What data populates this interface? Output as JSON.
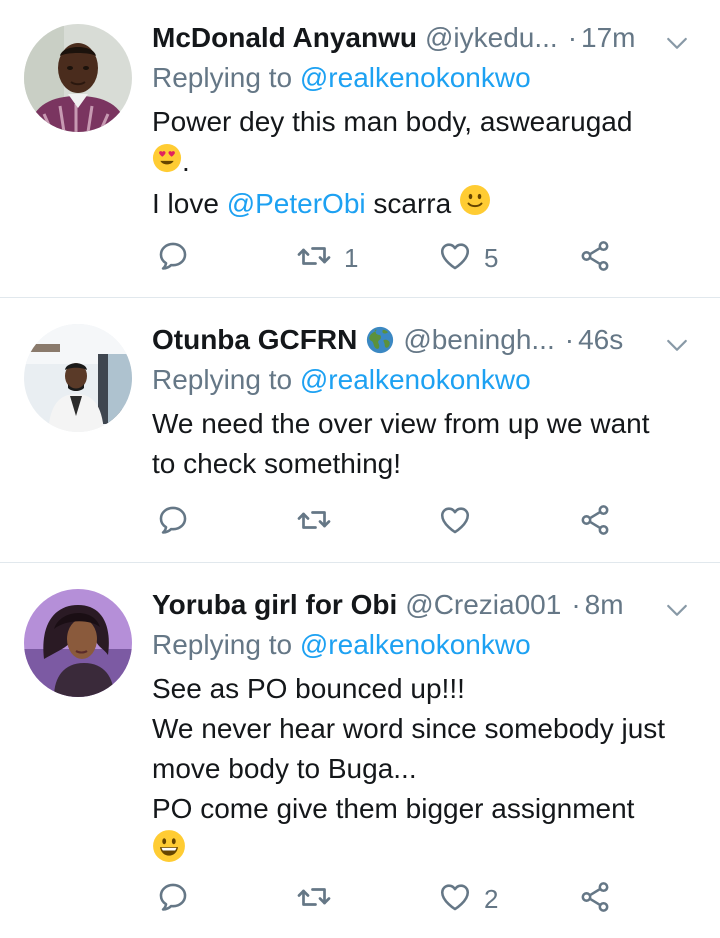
{
  "tweets": [
    {
      "name": "McDonald Anyanwu",
      "handle": "@iykedu...",
      "sep": "·",
      "time": "17m",
      "replying_prefix": "Replying to ",
      "replying_handle": "@realkenokonkwo",
      "lines": [
        {
          "text": "Power dey this man body, aswearugad"
        },
        {
          "text": ".",
          "emoji": "heart-eyes-emoji"
        },
        {
          "prefix": "I love ",
          "mention": "@PeterObi",
          "suffix": " scarra ",
          "emoji": "slightly-smiling-emoji"
        }
      ],
      "retweet_count": "1",
      "like_count": "5"
    },
    {
      "name": "Otunba GCFRN",
      "globe_icon": "globe-emoji",
      "handle": "@beningh...",
      "sep": "·",
      "time": "46s",
      "replying_prefix": "Replying to ",
      "replying_handle": "@realkenokonkwo",
      "lines": [
        {
          "text": "We need the over view from up we want"
        },
        {
          "text": "to check something!"
        }
      ],
      "retweet_count": "",
      "like_count": ""
    },
    {
      "name": "Yoruba girl for Obi",
      "handle": "@Crezia001",
      "sep": "·",
      "time": "8m",
      "replying_prefix": "Replying to ",
      "replying_handle": "@realkenokonkwo",
      "lines": [
        {
          "text": "See as PO bounced up!!!"
        },
        {
          "text": "We never hear word since somebody just"
        },
        {
          "text": "move body to Buga..."
        },
        {
          "text": "PO come give them bigger assignment"
        },
        {
          "emoji": "grinning-emoji"
        }
      ],
      "retweet_count": "",
      "like_count": "2"
    }
  ],
  "colors": {
    "text": "#14171a",
    "secondary": "#657786",
    "link": "#1da1f2",
    "divider": "#e1e8ed"
  }
}
